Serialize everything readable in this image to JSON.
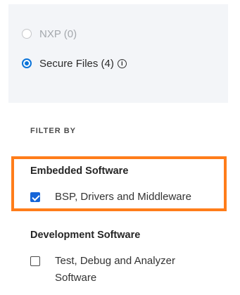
{
  "source_options": [
    {
      "label": "NXP (0)",
      "state": "disabled"
    },
    {
      "label": "Secure Files (4)",
      "state": "checked",
      "info_glyph": "i"
    }
  ],
  "filter_heading": "FILTER BY",
  "groups": [
    {
      "title": "Embedded Software",
      "highlighted": true,
      "highlight_color": "#ff7d1a",
      "items": [
        {
          "label": "BSP, Drivers and Middleware",
          "checked": true
        }
      ]
    },
    {
      "title": "Development Software",
      "highlighted": false,
      "items": [
        {
          "label_line1": "Test, Debug and Analyzer",
          "label_line2": "Software",
          "checked": false
        }
      ]
    }
  ],
  "colors": {
    "accent": "#0b74d9",
    "checkbox_checked": "#1565d8",
    "panel_bg": "#f3f5f8"
  }
}
